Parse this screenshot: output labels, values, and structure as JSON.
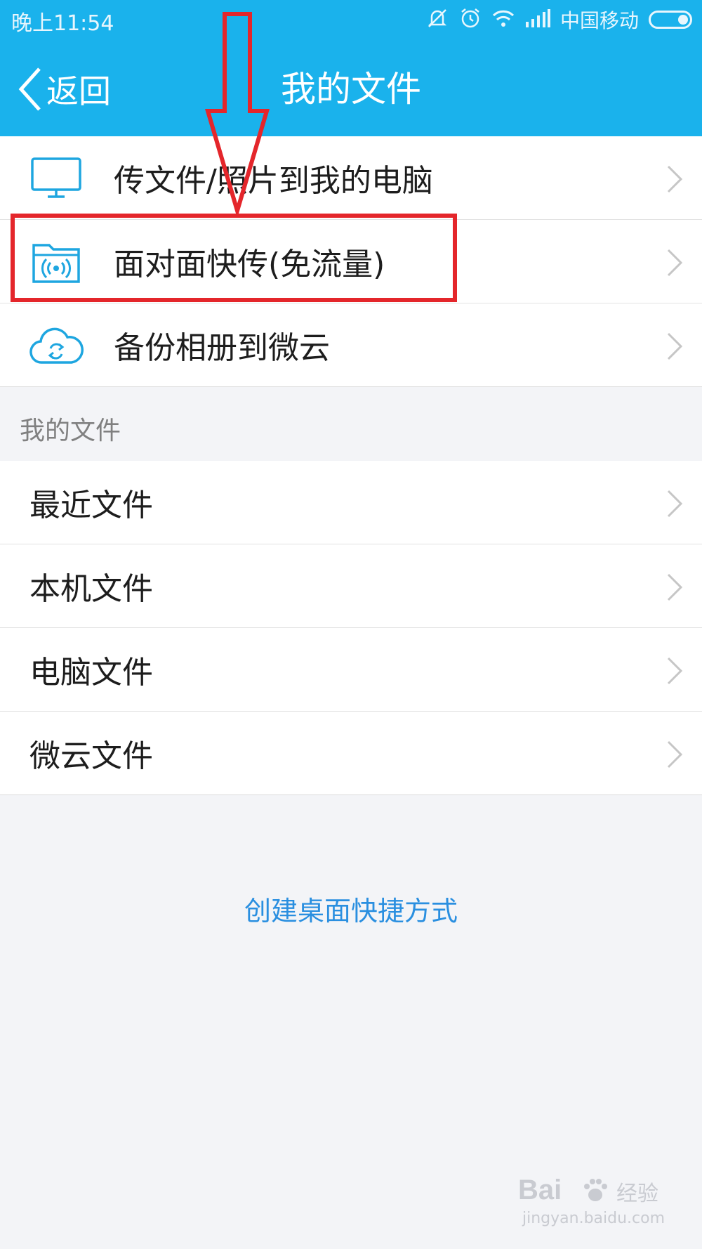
{
  "status_bar": {
    "time": "晚上11:54",
    "carrier": "中国移动",
    "icons": [
      "mute-icon",
      "alarm-icon",
      "wifi-icon",
      "signal-icon",
      "battery-icon"
    ]
  },
  "nav": {
    "back_label": "返回",
    "title": "我的文件"
  },
  "quick_actions": [
    {
      "label": "传文件/照片到我的电脑",
      "icon": "monitor-icon"
    },
    {
      "label": "面对面快传(免流量)",
      "icon": "folder-broadcast-icon"
    },
    {
      "label": "备份相册到微云",
      "icon": "cloud-sync-icon"
    }
  ],
  "files_section": {
    "title": "我的文件",
    "items": [
      {
        "label": "最近文件"
      },
      {
        "label": "本机文件"
      },
      {
        "label": "电脑文件"
      },
      {
        "label": "微云文件"
      }
    ]
  },
  "shortcut_link": "创建桌面快捷方式",
  "watermark": {
    "logo": "Bai",
    "logo_tail": "经验",
    "url": "jingyan.baidu.com"
  },
  "colors": {
    "accent": "#1ab2ec",
    "annotation": "#e4262b",
    "link": "#2a8fe0"
  }
}
